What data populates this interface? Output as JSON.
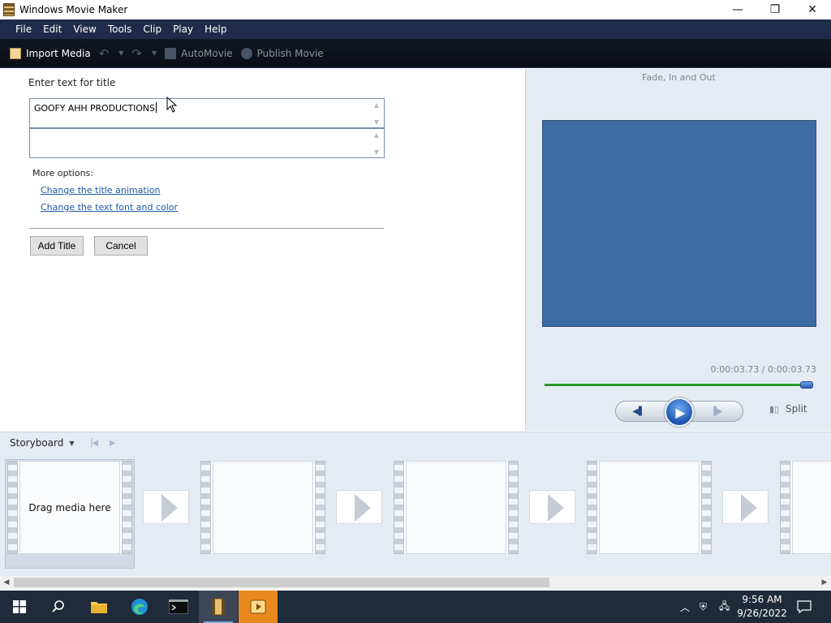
{
  "window": {
    "title": "Windows Movie Maker",
    "controls": {
      "minimize": "—",
      "restore": "❐",
      "close": "✕"
    }
  },
  "menu": [
    "File",
    "Edit",
    "View",
    "Tools",
    "Clip",
    "Play",
    "Help"
  ],
  "toolbar": {
    "import_label": "Import Media",
    "automovie_label": "AutoMovie",
    "publish_label": "Publish Movie"
  },
  "task": {
    "heading": "Enter text for title",
    "title_text": "GOOFY AHH PRODUCTIONS",
    "subtitle_text": "",
    "more_options": "More options:",
    "link_animation": "Change the title animation",
    "link_font": "Change the text font and color",
    "add_button": "Add Title",
    "cancel_button": "Cancel"
  },
  "preview": {
    "effect_name": "Fade, In and Out",
    "timecode": "0:00:03.73 / 0:00:03.73",
    "progress": 1.0,
    "split_label": "Split"
  },
  "storyboard": {
    "label": "Storyboard",
    "slot_hint": "Drag media here"
  },
  "taskbar": {
    "time": "9:56 AM",
    "date": "9/26/2022"
  },
  "colors": {
    "menubar": "#1f2c49",
    "monitor": "#3f6ba4",
    "link": "#1a5aa8",
    "seek": "#2a9a2a"
  }
}
